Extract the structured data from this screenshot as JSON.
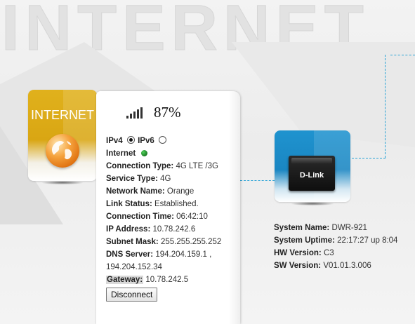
{
  "page": {
    "background_title": "INTERNET"
  },
  "internet_card": {
    "label": "INTERNET",
    "icon": "globe-icon",
    "color": "#d9a613"
  },
  "status_panel": {
    "signal_icon": "signal-bars-icon",
    "signal_percent": "87%",
    "ipv4_label": "IPv4",
    "ipv6_label": "IPv6",
    "ipv4_selected": true,
    "internet_label": "Internet",
    "internet_status_color": "#1a7a22",
    "fields": {
      "connection_type": {
        "label": "Connection Type:",
        "value": "4G LTE /3G"
      },
      "service_type": {
        "label": "Service Type:",
        "value": "4G"
      },
      "network_name": {
        "label": "Network Name:",
        "value": "Orange"
      },
      "link_status": {
        "label": "Link Status:",
        "value": "Established."
      },
      "connection_time": {
        "label": "Connection Time:",
        "value": "06:42:10"
      },
      "ip_address": {
        "label": "IP Address:",
        "value": "10.78.242.6"
      },
      "subnet_mask": {
        "label": "Subnet Mask:",
        "value": "255.255.255.252"
      },
      "dns_server": {
        "label": "DNS Server:",
        "value1": "194.204.159.1 ,",
        "value2": "194.204.152.34"
      },
      "gateway": {
        "label": "Gateway:",
        "value": "10.78.242.5"
      }
    },
    "disconnect_label": "Disconnect"
  },
  "device_card": {
    "logo": "D-Link",
    "icon": "router-device-icon",
    "color": "#1a86c2"
  },
  "system_info": {
    "system_name": {
      "label": "System Name:",
      "value": "DWR-921"
    },
    "system_uptime": {
      "label": "System Uptime:",
      "value": "22:17:27 up 8:04"
    },
    "hw_version": {
      "label": "HW Version:",
      "value": "C3"
    },
    "sw_version": {
      "label": "SW Version:",
      "value": "V01.01.3.006"
    }
  },
  "colors": {
    "connector_line": "#29a3d6"
  }
}
